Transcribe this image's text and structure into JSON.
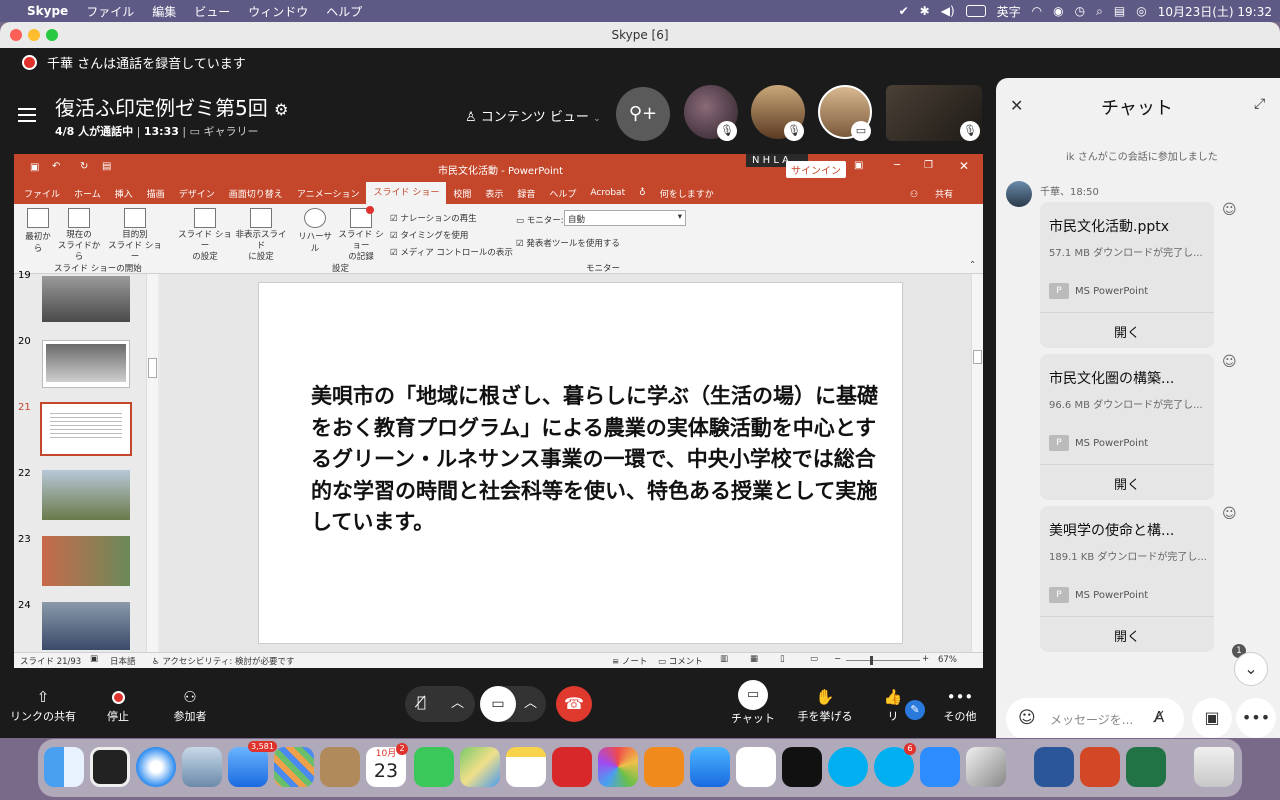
{
  "menubar": {
    "app": "Skype",
    "items": [
      "ファイル",
      "編集",
      "ビュー",
      "ウィンドウ",
      "ヘルプ"
    ],
    "input": "英字",
    "datetime": "10月23日(土)  19:32"
  },
  "window": {
    "title": "Skype [6]"
  },
  "recording": {
    "text": "千華 さんは通話を録音しています"
  },
  "meeting": {
    "title": "復活ふ印定例ゼミ第5回",
    "sub_count": "4/8 人が通話中",
    "sub_time": "13:33",
    "sub_view": "ギャラリー",
    "content_view": "コンテンツ ビュー"
  },
  "ppt": {
    "doc_title": "市民文化活動  -  PowerPoint",
    "tabs": [
      "ファイル",
      "ホーム",
      "挿入",
      "描画",
      "デザイン",
      "画面切り替え",
      "アニメーション",
      "スライド ショー",
      "校閲",
      "表示",
      "録音",
      "ヘルプ",
      "Acrobat",
      "何をしますか"
    ],
    "share": "共有",
    "overlay_label": "N H L A ...",
    "signin": "サインイン",
    "ribbon": {
      "from_start": "最初から",
      "from_current": "現在の\nスライドから",
      "custom": "目的別\nスライド ショー",
      "group1": "スライド ショーの開始",
      "setup": "スライド ショー\nの設定",
      "hide": "非表示スライド\nに設定",
      "rehearse": "リハーサル",
      "record": "スライド ショー\nの記録",
      "narration": "ナレーションの再生",
      "timing": "タイミングを使用",
      "media": "メディア コントロールの表示",
      "group2": "設定",
      "monitor_label": "モニター:",
      "monitor_value": "自動",
      "presenter": "発表者ツールを使用する",
      "group3": "モニター"
    },
    "slide_numbers": [
      "19",
      "20",
      "21",
      "22",
      "23",
      "24"
    ],
    "slide_text": "美唄市の「地域に根ざし、暮らしに学ぶ（生活の場）に基礎をおく教育プログラム」による農業の実体験活動を中心とするグリーン・ルネサンス事業の一環で、中央小学校では総合的な学習の時間と社会科等を使い、特色ある授業として実施しています。",
    "status": {
      "slide": "スライド 21/93",
      "lang": "日本語",
      "access": "アクセシビリティ: 検討が必要です",
      "notes": "ノート",
      "comments": "コメント",
      "zoom": "67%"
    }
  },
  "chat": {
    "title": "チャット",
    "system_msg": "ik さんがこの会話に参加しました",
    "sender": "千華、18:50",
    "files": [
      {
        "name": "市民文化活動.pptx",
        "size": "57.1 MB ダウンロードが完了し...",
        "type": "MS PowerPoint",
        "open": "開く"
      },
      {
        "name": "市民文化圏の構築...",
        "size": "96.6 MB ダウンロードが完了し...",
        "type": "MS PowerPoint",
        "open": "開く"
      },
      {
        "name": "美唄学の使命と構...",
        "size": "189.1 KB ダウンロードが完了し...",
        "type": "MS PowerPoint",
        "open": "開く"
      }
    ],
    "unread": "1",
    "placeholder": "メッセージを..."
  },
  "toolbar": {
    "share_link": "リンクの共有",
    "stop": "停止",
    "participants": "参加者",
    "chat": "チャット",
    "raise_hand": "手を挙げる",
    "react": "リ",
    "more": "その他"
  },
  "dock": {
    "mail_badge": "3,581",
    "calendar_month": "10月",
    "calendar_day": "23",
    "calendar_badge": "2",
    "skype_badge": "6"
  },
  "colors": {
    "ppt_red": "#c4472b",
    "end_call": "#e03a2f",
    "menubar": "#5e5a86"
  }
}
